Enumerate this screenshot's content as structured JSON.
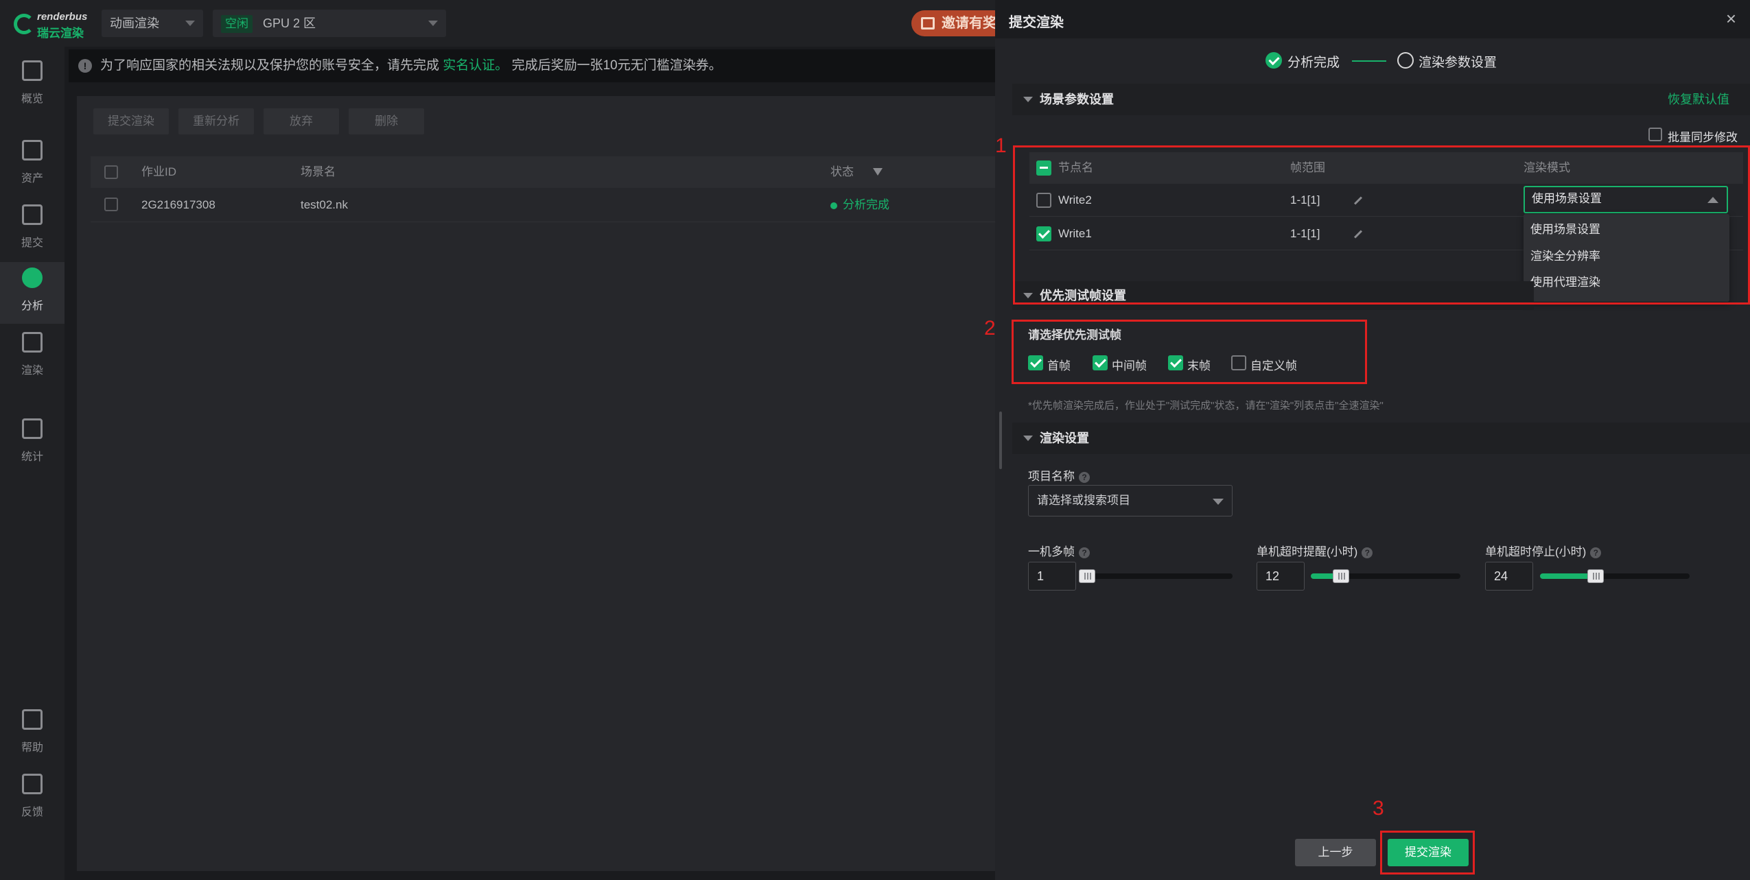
{
  "app": {
    "logo_en": "renderbus",
    "logo_cn": "瑞云渲染"
  },
  "topbar": {
    "mode_label": "动画渲染",
    "gpu_tag": "空闲",
    "gpu_label": "GPU 2 区",
    "invite_label": "邀请有奖"
  },
  "sidebar": {
    "items": [
      {
        "label": "概览",
        "icon": "activity-icon"
      },
      {
        "label": "资产",
        "icon": "folder-icon"
      },
      {
        "label": "提交",
        "icon": "upload-icon"
      },
      {
        "label": "分析",
        "icon": "analyze-icon"
      },
      {
        "label": "渲染",
        "icon": "render-icon"
      },
      {
        "label": "统计",
        "icon": "chart-icon"
      },
      {
        "label": "帮助",
        "icon": "help-doc-icon"
      },
      {
        "label": "反馈",
        "icon": "feedback-icon"
      }
    ]
  },
  "notice": {
    "text_before": "为了响应国家的相关法规以及保护您的账号安全，请先完成",
    "link": "实名认证。",
    "text_after": "完成后奖励一张10元无门槛渲染券。"
  },
  "toolbar": {
    "submit": "提交渲染",
    "reanalyze": "重新分析",
    "abandon": "放弃",
    "delete": "删除"
  },
  "jobs": {
    "columns": {
      "id": "作业ID",
      "scene": "场景名",
      "status": "状态"
    },
    "rows": [
      {
        "id": "2G216917308",
        "scene": "test02.nk",
        "status": "分析完成"
      }
    ]
  },
  "panel": {
    "title": "提交渲染",
    "close": "×",
    "steps": {
      "step1": "分析完成",
      "step2": "渲染参数设置"
    },
    "scene_section": {
      "title": "场景参数设置",
      "restore": "恢复默认值",
      "batch_sync": "批量同步修改",
      "columns": {
        "node": "节点名",
        "frames": "帧范围",
        "mode": "渲染模式"
      },
      "rows": [
        {
          "node": "Write2",
          "frames": "1-1[1]",
          "mode": "使用场景设置",
          "checked": false
        },
        {
          "node": "Write1",
          "frames": "1-1[1]",
          "mode": "",
          "checked": true
        }
      ],
      "mode_options": [
        "使用场景设置",
        "渲染全分辨率",
        "使用代理渲染"
      ]
    },
    "priority_section": {
      "title": "优先测试帧设置",
      "prompt": "请选择优先测试帧",
      "options": [
        {
          "label": "首帧",
          "checked": true
        },
        {
          "label": "中间帧",
          "checked": true
        },
        {
          "label": "末帧",
          "checked": true
        },
        {
          "label": "自定义帧",
          "checked": false
        }
      ],
      "hint": "*优先帧渲染完成后，作业处于\"测试完成\"状态，请在\"渲染\"列表点击\"全速渲染\""
    },
    "render_section": {
      "title": "渲染设置",
      "project_label": "项目名称",
      "project_placeholder": "请选择或搜索项目",
      "multi_frame_label": "一机多帧",
      "multi_frame_value": "1",
      "multi_frame_fraction": 0.02,
      "timeout_warn_label": "单机超时提醒(小时)",
      "timeout_warn_value": "12",
      "timeout_warn_fraction": 0.2,
      "timeout_stop_label": "单机超时停止(小时)",
      "timeout_stop_value": "24",
      "timeout_stop_fraction": 0.37
    },
    "footer": {
      "prev": "上一步",
      "submit": "提交渲染"
    }
  },
  "annotations": {
    "n1": "1",
    "n2": "2",
    "n3": "3"
  },
  "colors": {
    "accent": "#18b36b",
    "annotation_red": "#e02020",
    "panel_bg": "#232428"
  }
}
